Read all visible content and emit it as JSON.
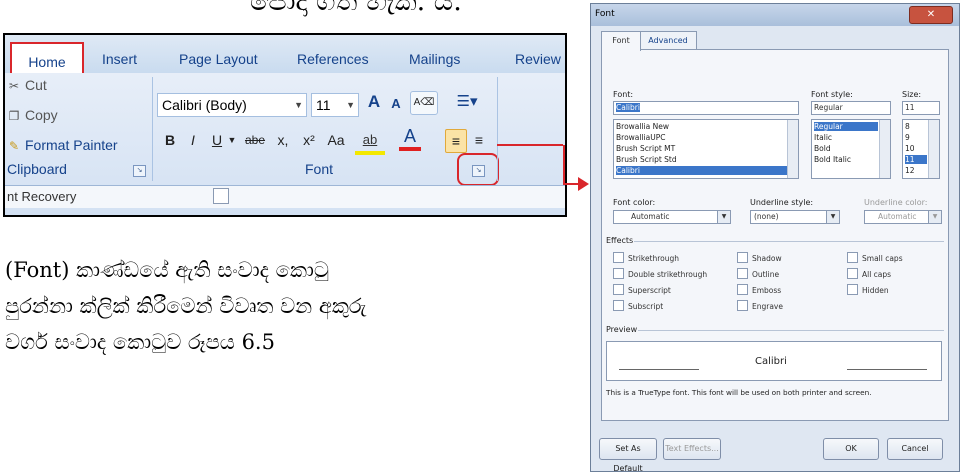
{
  "page": {
    "top_text": "පොදා ගත හැක. ය.",
    "paragraph_lines": [
      "(Font) කාණ්ඩයේ ඇති සංවාද කොටු",
      "පුරන්නා ක්ලික් කිරීමෙන් විවෘත වන අකුරු",
      "වර්ග සංවාද කොටුව රූපය 6.5"
    ],
    "accent_color": "#d9262b"
  },
  "ribbon": {
    "tabs": [
      "Home",
      "Insert",
      "Page Layout",
      "References",
      "Mailings",
      "Review"
    ],
    "clipboard": {
      "cut": "Cut",
      "copy": "Copy",
      "format_painter": "Format Painter",
      "group_label": "Clipboard"
    },
    "font": {
      "font_name": "Calibri (Body)",
      "font_size": "11",
      "group_label": "Font",
      "grow": "A",
      "shrink": "A",
      "bold": "B",
      "italic": "I",
      "underline": "U",
      "strike": "abe",
      "subscript": "x,",
      "superscript": "x²",
      "change_case": "Aa",
      "highlight": "ab",
      "font_color": "A"
    },
    "bottom_text": "nt Recovery"
  },
  "dialog": {
    "title": "Font",
    "close": "✕",
    "tabs": [
      "Font",
      "Advanced"
    ],
    "font_label": "Font:",
    "font_value": "Calibri",
    "font_list": [
      "Browallia New",
      "BrowalliaUPC",
      "Brush Script MT",
      "Brush Script Std",
      "Calibri"
    ],
    "style_label": "Font style:",
    "style_value": "Regular",
    "style_list": [
      "Regular",
      "Italic",
      "Bold",
      "Bold Italic"
    ],
    "size_label": "Size:",
    "size_value": "11",
    "size_list": [
      "8",
      "9",
      "10",
      "11",
      "12"
    ],
    "font_color_label": "Font color:",
    "font_color_value": "Automatic",
    "underline_label": "Underline style:",
    "underline_value": "(none)",
    "underline_color_label": "Underline color:",
    "underline_color_value": "Automatic",
    "effects_label": "Effects",
    "effects": [
      [
        "Strikethrough",
        "Shadow",
        "Small caps"
      ],
      [
        "Double strikethrough",
        "Outline",
        "All caps"
      ],
      [
        "Superscript",
        "Emboss",
        "Hidden"
      ],
      [
        "Subscript",
        "Engrave",
        ""
      ]
    ],
    "preview_label": "Preview",
    "preview_text": "Calibri",
    "note": "This is a TrueType font. This font will be used on both printer and screen.",
    "buttons": {
      "default": "Set As Default",
      "effects": "Text Effects...",
      "ok": "OK",
      "cancel": "Cancel"
    }
  }
}
